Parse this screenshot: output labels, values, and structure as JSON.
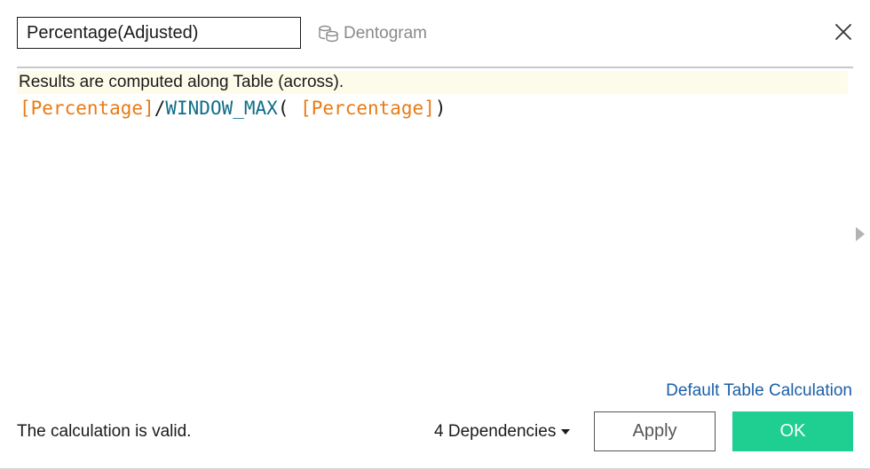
{
  "calc_name": {
    "value": "Percentage(Adjusted)"
  },
  "datasource": {
    "label": "Dentogram",
    "icon": "datasource-cylinders-icon"
  },
  "close": {
    "icon": "close-icon"
  },
  "editor": {
    "info": "Results are computed along Table (across).",
    "tokens": [
      {
        "type": "field",
        "text": "[Percentage]"
      },
      {
        "type": "op",
        "text": "/"
      },
      {
        "type": "func",
        "text": "WINDOW_MAX"
      },
      {
        "type": "op",
        "text": "("
      },
      {
        "type": "op",
        "text": " "
      },
      {
        "type": "field",
        "text": "[Percentage]"
      },
      {
        "type": "op",
        "text": ")"
      }
    ]
  },
  "side_panel": {
    "icon": "expand-right-arrow-icon"
  },
  "footer": {
    "default_table_calc_link": "Default Table Calculation",
    "status": "The calculation is valid.",
    "dependencies": "4 Dependencies",
    "apply_label": "Apply",
    "ok_label": "OK"
  },
  "colors": {
    "field": "#e87b16",
    "function": "#0f6d87",
    "ok_button": "#1fcf91",
    "link": "#1b5fa8",
    "info_bar": "#fdfbe9"
  }
}
